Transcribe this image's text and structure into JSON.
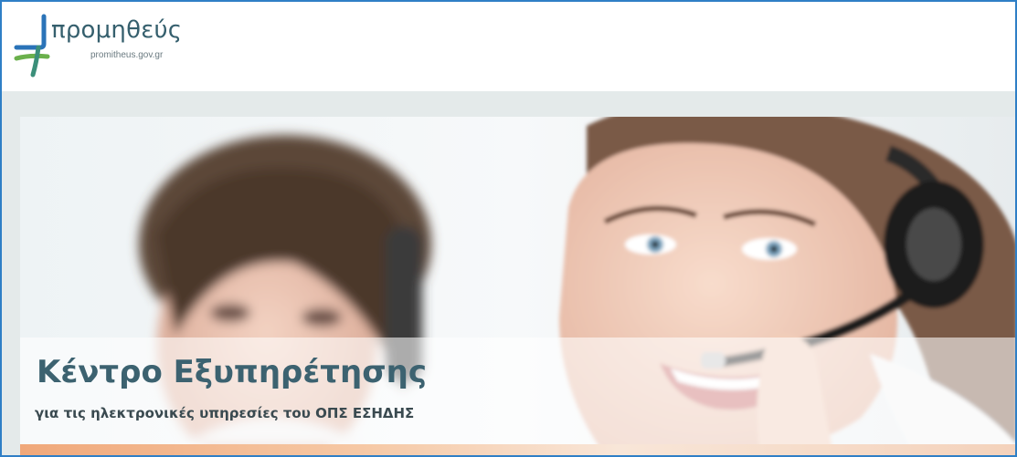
{
  "header": {
    "logo": {
      "name": "προμηθεύς",
      "domain": "promitheus.gov.gr",
      "icon": "promitheus-logo-icon",
      "colors": {
        "blue": "#2a73b8",
        "green": "#6ab04c",
        "teal": "#355f6d"
      }
    }
  },
  "banner": {
    "image": "call-center-agents-with-headsets",
    "title": "Κέντρο Εξυπηρέτησης",
    "subtitle": "για τις ηλεκτρονικές υπηρεσίες του ΟΠΣ ΕΣΗΔΗΣ"
  },
  "colors": {
    "frame_border": "#2f7fc6",
    "title_text": "#3c6270"
  }
}
